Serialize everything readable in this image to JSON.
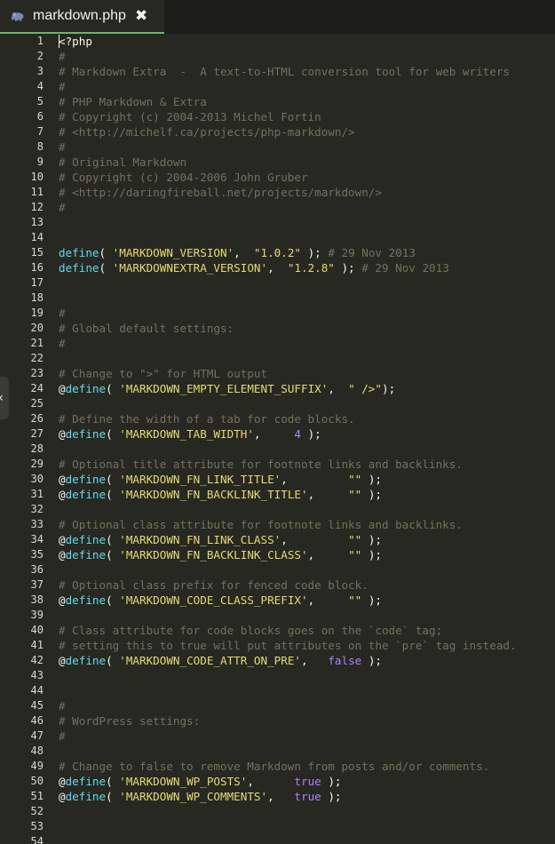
{
  "tab": {
    "title": "markdown.php",
    "close_glyph": "✖",
    "icon": "elephant-icon"
  },
  "side_toggle": {
    "glyph": "‹",
    "icon": "chevron-left-icon"
  },
  "colors": {
    "background": "#272822",
    "comment": "#75715e",
    "keyword": "#66d9ef",
    "string": "#e6db74",
    "constant": "#ae81ff",
    "text": "#f8f8f2",
    "tab_underline": "#6db36d"
  },
  "lines": [
    {
      "n": "1",
      "t": [
        [
          "o",
          "<?php"
        ]
      ]
    },
    {
      "n": "2",
      "t": [
        [
          "c",
          "#"
        ]
      ]
    },
    {
      "n": "3",
      "t": [
        [
          "c",
          "# Markdown Extra  -  A text-to-HTML conversion tool for web writers"
        ]
      ]
    },
    {
      "n": "4",
      "t": [
        [
          "c",
          "#"
        ]
      ]
    },
    {
      "n": "5",
      "t": [
        [
          "c",
          "# PHP Markdown & Extra"
        ]
      ]
    },
    {
      "n": "6",
      "t": [
        [
          "c",
          "# Copyright (c) 2004-2013 Michel Fortin"
        ]
      ]
    },
    {
      "n": "7",
      "t": [
        [
          "c",
          "# <http://michelf.ca/projects/php-markdown/>"
        ]
      ]
    },
    {
      "n": "8",
      "t": [
        [
          "c",
          "#"
        ]
      ]
    },
    {
      "n": "9",
      "t": [
        [
          "c",
          "# Original Markdown"
        ]
      ]
    },
    {
      "n": "10",
      "t": [
        [
          "c",
          "# Copyright (c) 2004-2006 John Gruber"
        ]
      ]
    },
    {
      "n": "11",
      "t": [
        [
          "c",
          "# <http://daringfireball.net/projects/markdown/>"
        ]
      ]
    },
    {
      "n": "12",
      "t": [
        [
          "c",
          "#"
        ]
      ]
    },
    {
      "n": "13",
      "t": []
    },
    {
      "n": "14",
      "t": []
    },
    {
      "n": "15",
      "t": [
        [
          "k",
          "define"
        ],
        [
          "o",
          "( "
        ],
        [
          "s",
          "'MARKDOWN_VERSION'"
        ],
        [
          "o",
          ",  "
        ],
        [
          "s",
          "\"1.0.2\""
        ],
        [
          "o",
          " ); "
        ],
        [
          "c",
          "# 29 Nov 2013"
        ]
      ]
    },
    {
      "n": "16",
      "t": [
        [
          "k",
          "define"
        ],
        [
          "o",
          "( "
        ],
        [
          "s",
          "'MARKDOWNEXTRA_VERSION'"
        ],
        [
          "o",
          ",  "
        ],
        [
          "s",
          "\"1.2.8\""
        ],
        [
          "o",
          " ); "
        ],
        [
          "c",
          "# 29 Nov 2013"
        ]
      ]
    },
    {
      "n": "17",
      "t": []
    },
    {
      "n": "18",
      "t": []
    },
    {
      "n": "19",
      "t": [
        [
          "c",
          "#"
        ]
      ]
    },
    {
      "n": "20",
      "t": [
        [
          "c",
          "# Global default settings:"
        ]
      ]
    },
    {
      "n": "21",
      "t": [
        [
          "c",
          "#"
        ]
      ]
    },
    {
      "n": "22",
      "t": []
    },
    {
      "n": "23",
      "t": [
        [
          "c",
          "# Change to \">\" for HTML output"
        ]
      ]
    },
    {
      "n": "24",
      "t": [
        [
          "o",
          "@"
        ],
        [
          "k",
          "define"
        ],
        [
          "o",
          "( "
        ],
        [
          "s",
          "'MARKDOWN_EMPTY_ELEMENT_SUFFIX'"
        ],
        [
          "o",
          ",  "
        ],
        [
          "s",
          "\" />\""
        ],
        [
          "o",
          ");"
        ]
      ]
    },
    {
      "n": "25",
      "t": []
    },
    {
      "n": "26",
      "t": [
        [
          "c",
          "# Define the width of a tab for code blocks."
        ]
      ]
    },
    {
      "n": "27",
      "t": [
        [
          "o",
          "@"
        ],
        [
          "k",
          "define"
        ],
        [
          "o",
          "( "
        ],
        [
          "s",
          "'MARKDOWN_TAB_WIDTH'"
        ],
        [
          "o",
          ",     "
        ],
        [
          "n",
          "4"
        ],
        [
          "o",
          " );"
        ]
      ]
    },
    {
      "n": "28",
      "t": []
    },
    {
      "n": "29",
      "t": [
        [
          "c",
          "# Optional title attribute for footnote links and backlinks."
        ]
      ]
    },
    {
      "n": "30",
      "t": [
        [
          "o",
          "@"
        ],
        [
          "k",
          "define"
        ],
        [
          "o",
          "( "
        ],
        [
          "s",
          "'MARKDOWN_FN_LINK_TITLE'"
        ],
        [
          "o",
          ",         "
        ],
        [
          "s",
          "\"\""
        ],
        [
          "o",
          " );"
        ]
      ]
    },
    {
      "n": "31",
      "t": [
        [
          "o",
          "@"
        ],
        [
          "k",
          "define"
        ],
        [
          "o",
          "( "
        ],
        [
          "s",
          "'MARKDOWN_FN_BACKLINK_TITLE'"
        ],
        [
          "o",
          ",     "
        ],
        [
          "s",
          "\"\""
        ],
        [
          "o",
          " );"
        ]
      ]
    },
    {
      "n": "32",
      "t": []
    },
    {
      "n": "33",
      "t": [
        [
          "c",
          "# Optional class attribute for footnote links and backlinks."
        ]
      ]
    },
    {
      "n": "34",
      "t": [
        [
          "o",
          "@"
        ],
        [
          "k",
          "define"
        ],
        [
          "o",
          "( "
        ],
        [
          "s",
          "'MARKDOWN_FN_LINK_CLASS'"
        ],
        [
          "o",
          ",         "
        ],
        [
          "s",
          "\"\""
        ],
        [
          "o",
          " );"
        ]
      ]
    },
    {
      "n": "35",
      "t": [
        [
          "o",
          "@"
        ],
        [
          "k",
          "define"
        ],
        [
          "o",
          "( "
        ],
        [
          "s",
          "'MARKDOWN_FN_BACKLINK_CLASS'"
        ],
        [
          "o",
          ",     "
        ],
        [
          "s",
          "\"\""
        ],
        [
          "o",
          " );"
        ]
      ]
    },
    {
      "n": "36",
      "t": []
    },
    {
      "n": "37",
      "t": [
        [
          "c",
          "# Optional class prefix for fenced code block."
        ]
      ]
    },
    {
      "n": "38",
      "t": [
        [
          "o",
          "@"
        ],
        [
          "k",
          "define"
        ],
        [
          "o",
          "( "
        ],
        [
          "s",
          "'MARKDOWN_CODE_CLASS_PREFIX'"
        ],
        [
          "o",
          ",     "
        ],
        [
          "s",
          "\"\""
        ],
        [
          "o",
          " );"
        ]
      ]
    },
    {
      "n": "39",
      "t": []
    },
    {
      "n": "40",
      "t": [
        [
          "c",
          "# Class attribute for code blocks goes on the `code` tag;"
        ]
      ]
    },
    {
      "n": "41",
      "t": [
        [
          "c",
          "# setting this to true will put attributes on the `pre` tag instead."
        ]
      ]
    },
    {
      "n": "42",
      "t": [
        [
          "o",
          "@"
        ],
        [
          "k",
          "define"
        ],
        [
          "o",
          "( "
        ],
        [
          "s",
          "'MARKDOWN_CODE_ATTR_ON_PRE'"
        ],
        [
          "o",
          ",   "
        ],
        [
          "n",
          "false"
        ],
        [
          "o",
          " );"
        ]
      ]
    },
    {
      "n": "43",
      "t": []
    },
    {
      "n": "44",
      "t": []
    },
    {
      "n": "45",
      "t": [
        [
          "c",
          "#"
        ]
      ]
    },
    {
      "n": "46",
      "t": [
        [
          "c",
          "# WordPress settings:"
        ]
      ]
    },
    {
      "n": "47",
      "t": [
        [
          "c",
          "#"
        ]
      ]
    },
    {
      "n": "48",
      "t": []
    },
    {
      "n": "49",
      "t": [
        [
          "c",
          "# Change to false to remove Markdown from posts and/or comments."
        ]
      ]
    },
    {
      "n": "50",
      "t": [
        [
          "o",
          "@"
        ],
        [
          "k",
          "define"
        ],
        [
          "o",
          "( "
        ],
        [
          "s",
          "'MARKDOWN_WP_POSTS'"
        ],
        [
          "o",
          ",      "
        ],
        [
          "n",
          "true"
        ],
        [
          "o",
          " );"
        ]
      ]
    },
    {
      "n": "51",
      "t": [
        [
          "o",
          "@"
        ],
        [
          "k",
          "define"
        ],
        [
          "o",
          "( "
        ],
        [
          "s",
          "'MARKDOWN_WP_COMMENTS'"
        ],
        [
          "o",
          ",   "
        ],
        [
          "n",
          "true"
        ],
        [
          "o",
          " );"
        ]
      ]
    },
    {
      "n": "52",
      "t": []
    },
    {
      "n": "53",
      "t": []
    },
    {
      "n": "54",
      "t": []
    }
  ]
}
